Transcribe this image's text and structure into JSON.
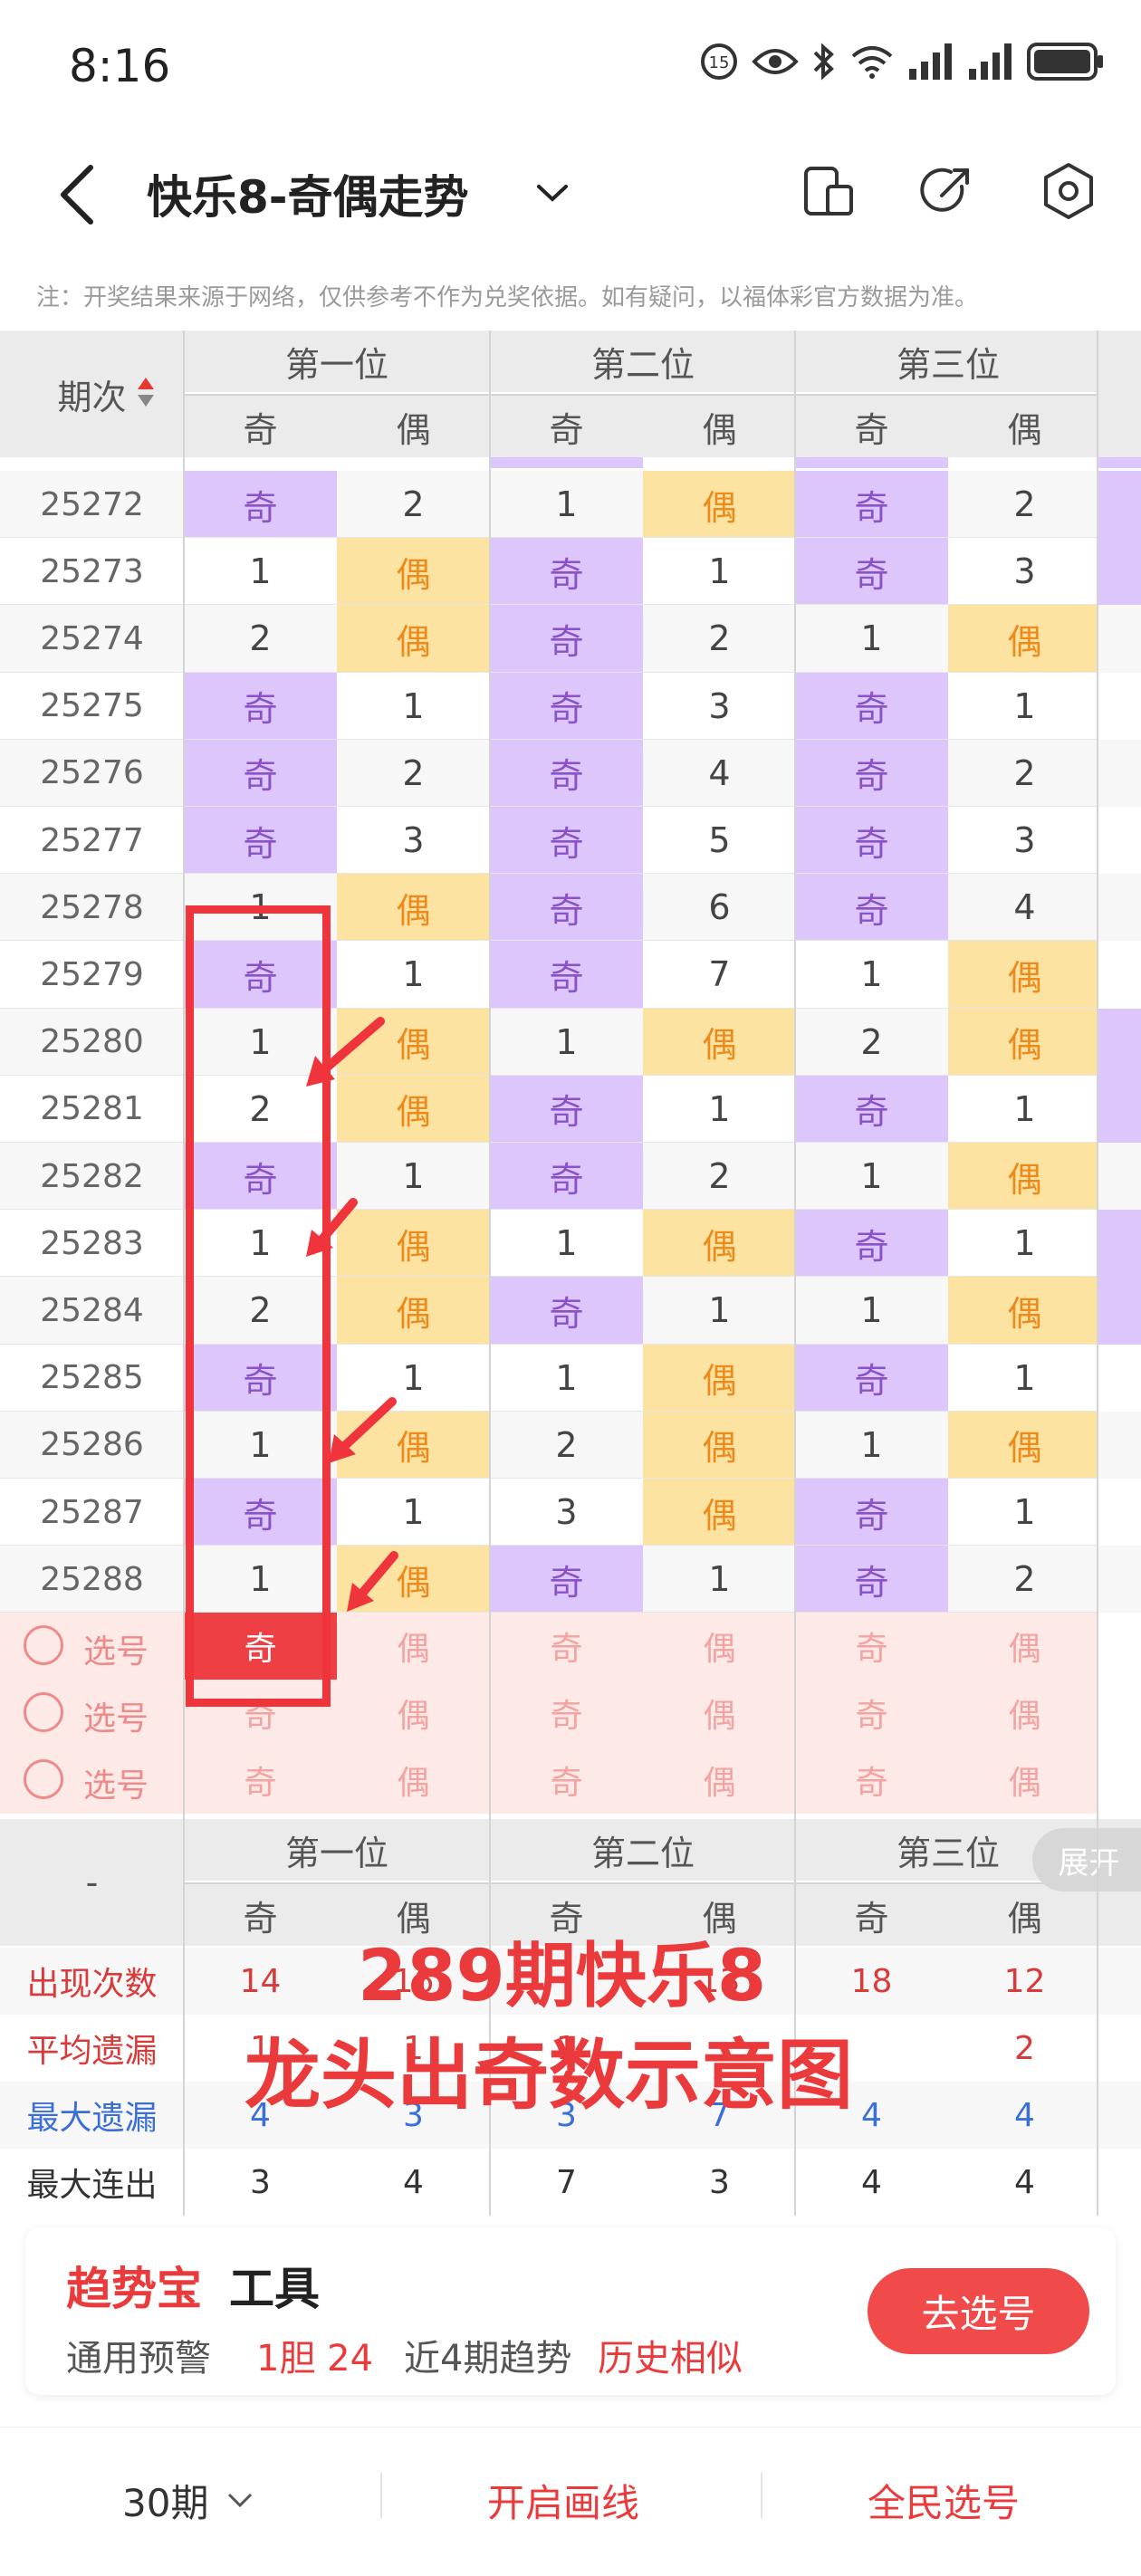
{
  "status": {
    "time": "8:16"
  },
  "header": {
    "title": "快乐8-奇偶走势"
  },
  "note": "注：开奖结果来源于网络，仅供参考不作为兑奖依据。如有疑问，以福体彩官方数据为准。",
  "table": {
    "period_header": "期次",
    "positions": [
      "第一位",
      "第二位",
      "第三位"
    ],
    "odd_label": "奇",
    "even_label": "偶",
    "rows": [
      {
        "period": "25272",
        "cells": [
          "O",
          "2",
          "1",
          "E",
          "O",
          "2"
        ]
      },
      {
        "period": "25273",
        "cells": [
          "1",
          "E",
          "O",
          "1",
          "O",
          "3"
        ]
      },
      {
        "period": "25274",
        "cells": [
          "2",
          "E",
          "O",
          "2",
          "1",
          "E"
        ]
      },
      {
        "period": "25275",
        "cells": [
          "O",
          "1",
          "O",
          "3",
          "O",
          "1"
        ]
      },
      {
        "period": "25276",
        "cells": [
          "O",
          "2",
          "O",
          "4",
          "O",
          "2"
        ]
      },
      {
        "period": "25277",
        "cells": [
          "O",
          "3",
          "O",
          "5",
          "O",
          "3"
        ]
      },
      {
        "period": "25278",
        "cells": [
          "1",
          "E",
          "O",
          "6",
          "O",
          "4"
        ]
      },
      {
        "period": "25279",
        "cells": [
          "O",
          "1",
          "O",
          "7",
          "1",
          "E"
        ]
      },
      {
        "period": "25280",
        "cells": [
          "1",
          "E",
          "1",
          "E",
          "2",
          "E"
        ]
      },
      {
        "period": "25281",
        "cells": [
          "2",
          "E",
          "O",
          "1",
          "O",
          "1"
        ]
      },
      {
        "period": "25282",
        "cells": [
          "O",
          "1",
          "O",
          "2",
          "1",
          "E"
        ]
      },
      {
        "period": "25283",
        "cells": [
          "1",
          "E",
          "1",
          "E",
          "O",
          "1"
        ]
      },
      {
        "period": "25284",
        "cells": [
          "2",
          "E",
          "O",
          "1",
          "1",
          "E"
        ]
      },
      {
        "period": "25285",
        "cells": [
          "O",
          "1",
          "1",
          "E",
          "O",
          "1"
        ]
      },
      {
        "period": "25286",
        "cells": [
          "1",
          "E",
          "2",
          "E",
          "1",
          "E"
        ]
      },
      {
        "period": "25287",
        "cells": [
          "O",
          "1",
          "3",
          "E",
          "O",
          "1"
        ]
      },
      {
        "period": "25288",
        "cells": [
          "1",
          "E",
          "O",
          "1",
          "O",
          "2"
        ]
      }
    ],
    "select_label": "选号",
    "stats_dash": "-",
    "stats": [
      {
        "label": "出现次数",
        "values": [
          "14",
          "16",
          "",
          "13",
          "18",
          "12"
        ],
        "color": "#d93a3a"
      },
      {
        "label": "平均遗漏",
        "values": [
          "1",
          "1",
          "1",
          "",
          "",
          "2"
        ],
        "color": "#d93a3a"
      },
      {
        "label": "最大遗漏",
        "values": [
          "4",
          "3",
          "3",
          "7",
          "4",
          "4"
        ],
        "color": "#3a6fd9"
      },
      {
        "label": "最大连出",
        "values": [
          "3",
          "4",
          "7",
          "3",
          "4",
          "4"
        ],
        "color": "#333333"
      }
    ],
    "expand_label": "展开"
  },
  "overlay": {
    "line1": "289期快乐8",
    "line2": "龙头出奇数示意图"
  },
  "trend_card": {
    "brand": "趋势宝",
    "tool": "工具",
    "items": [
      "通用预警",
      "1胆 24",
      "近4期趋势",
      "历史相似"
    ],
    "button": "去选号"
  },
  "bottom": {
    "periods": "30期",
    "draw_line": "开启画线",
    "pick": "全民选号"
  },
  "colors": {
    "accent": "#f04a4a",
    "odd_bg": "#dcc6fb",
    "even_bg": "#fde3a2"
  }
}
